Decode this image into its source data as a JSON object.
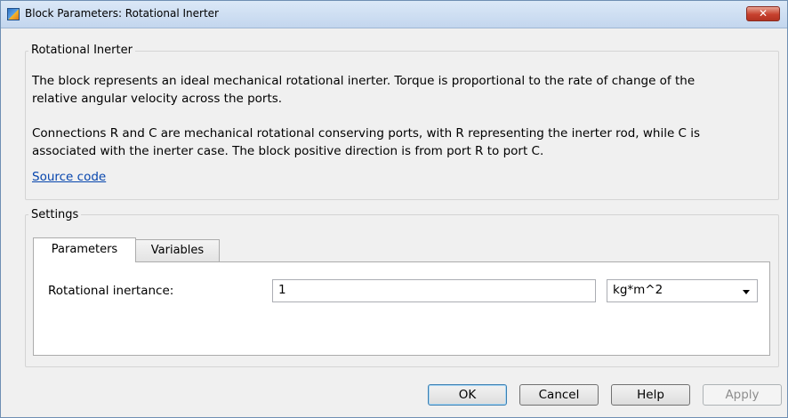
{
  "window": {
    "title": "Block Parameters: Rotational Inerter",
    "close_glyph": "✕",
    "icon": "simulink-app-icon"
  },
  "description": {
    "group_label": "Rotational Inerter",
    "paragraph1_line1": "The block represents an ideal mechanical rotational inerter. Torque is proportional to the rate of change of the",
    "paragraph1_line2": "relative angular velocity across the ports.",
    "paragraph2_line1": "Connections R and C are mechanical rotational conserving ports, with R representing the inerter rod, while C is",
    "paragraph2_line2": "associated with the inerter case. The block positive direction is from port R to port C.",
    "source_link": "Source code"
  },
  "settings": {
    "group_label": "Settings",
    "tabs": [
      {
        "label": "Parameters",
        "active": true
      },
      {
        "label": "Variables",
        "active": false
      }
    ],
    "parameters": [
      {
        "label": "Rotational inertance:",
        "value": "1",
        "unit": "kg*m^2"
      }
    ]
  },
  "buttons": {
    "ok": "OK",
    "cancel": "Cancel",
    "help": "Help",
    "apply": "Apply"
  }
}
